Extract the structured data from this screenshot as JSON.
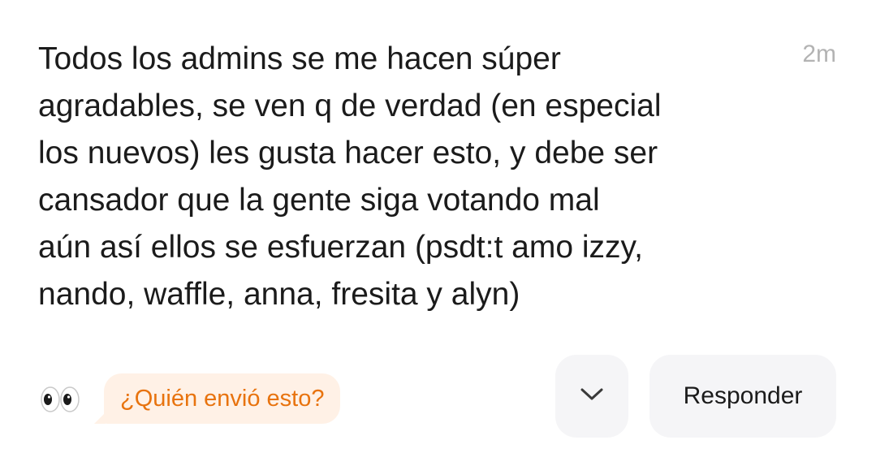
{
  "message": {
    "lines": [
      "Todos los admins se me hacen súper",
      "agradables, se ven q de verdad (en especial",
      "los nuevos) les gusta hacer esto, y debe ser",
      "cansador que la gente siga votando mal",
      "aún así ellos se esfuerzan (psdt:t amo izzy,",
      "nando, waffle, anna, fresita y alyn)"
    ],
    "timestamp": "2m"
  },
  "footer": {
    "reaction_icon": "eyes-emoji",
    "who_sent_label": "¿Quién envió esto?",
    "more_icon": "chevron-down-icon",
    "reply_label": "Responder"
  },
  "colors": {
    "accent": "#e8730e",
    "accent_bg": "#fff1e6",
    "button_bg": "#f5f5f7",
    "text": "#1b1b1b",
    "muted": "#b3b3b3"
  }
}
